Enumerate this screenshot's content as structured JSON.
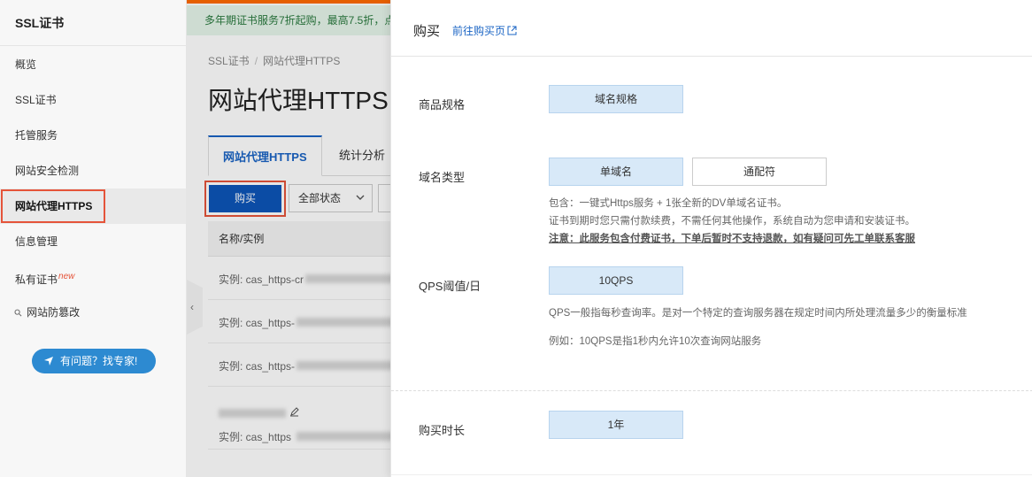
{
  "sidebar": {
    "title": "SSL证书",
    "items": [
      {
        "label": "概览"
      },
      {
        "label": "SSL证书"
      },
      {
        "label": "托管服务"
      },
      {
        "label": "网站安全检测"
      },
      {
        "label": "网站代理HTTPS"
      },
      {
        "label": "信息管理"
      },
      {
        "label": "私有证书",
        "badge": "new"
      },
      {
        "label": "网站防篡改",
        "icon": "link-icon"
      }
    ],
    "help_button": "有问题？找专家!"
  },
  "main": {
    "banner": "多年期证书服务7折起购，最高7.5折，点",
    "breadcrumb": [
      "SSL证书",
      "网站代理HTTPS"
    ],
    "title": "网站代理HTTPS",
    "tabs": [
      {
        "label": "网站代理HTTPS"
      },
      {
        "label": "统计分析"
      }
    ],
    "buy_button": "购买",
    "status_filter": "全部状态",
    "table_header": "名称/实例",
    "rows": [
      {
        "text": "实例: cas_https-cr"
      },
      {
        "text": "实例: cas_https-"
      },
      {
        "text": "实例: cas_https-"
      },
      {
        "text": "实例: cas_https"
      }
    ]
  },
  "drawer": {
    "title": "购买",
    "link": "前往购买页",
    "spec": {
      "label": "商品规格",
      "options": [
        {
          "label": "域名规格",
          "selected": true
        }
      ]
    },
    "domain_type": {
      "label": "域名类型",
      "options": [
        {
          "label": "单域名",
          "selected": true
        },
        {
          "label": "通配符",
          "selected": false
        }
      ],
      "notes": [
        "包含：一键式Https服务 + 1张全新的DV单域名证书。",
        "证书到期时您只需付款续费，不需任何其他操作，系统自动为您申请和安装证书。"
      ],
      "warning": "注意：此服务包含付费证书，下单后暂时不支持退款，如有疑问可先工单联系客服"
    },
    "qps": {
      "label": "QPS阈值/日",
      "options": [
        {
          "label": "10QPS",
          "selected": true
        }
      ],
      "note1": "QPS一般指每秒查询率。是对一个特定的查询服务器在规定时间内所处理流量多少的衡量标准",
      "note2": "例如：10QPS是指1秒内允许10次查询网站服务"
    },
    "duration": {
      "label": "购买时长",
      "options": [
        {
          "label": "1年",
          "selected": true
        }
      ]
    }
  },
  "colors": {
    "accent": "#1a64c4",
    "button": "#0d55b8",
    "highlight": "#e5543a",
    "selected": "#d8e9f8"
  }
}
